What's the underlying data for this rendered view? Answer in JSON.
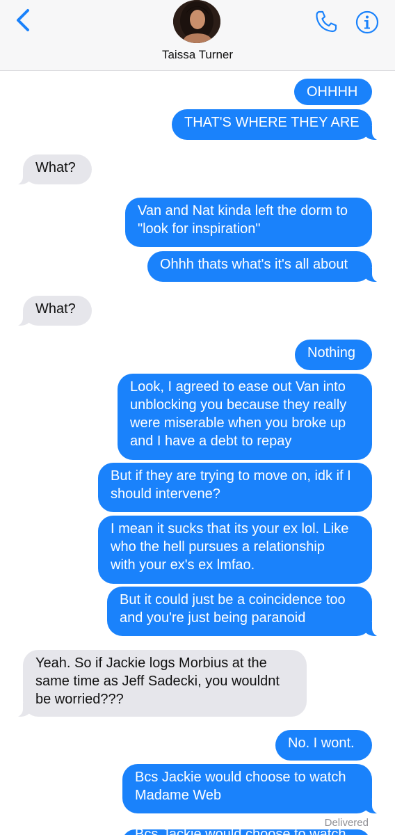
{
  "header": {
    "contact_name": "Taissa Turner",
    "accent_color": "#1a82fb",
    "icons": [
      "back-chevron-icon",
      "phone-icon",
      "info-icon"
    ]
  },
  "messages": [
    {
      "from": "me",
      "text": "OHHHH"
    },
    {
      "from": "me",
      "text": "THAT'S WHERE THEY ARE"
    },
    {
      "from": "them",
      "text": "What?"
    },
    {
      "from": "me",
      "text": "Van and Nat kinda left the dorm to\n\"look for inspiration\""
    },
    {
      "from": "me",
      "text": "Ohhh thats what's it's all about"
    },
    {
      "from": "them",
      "text": "What?"
    },
    {
      "from": "me",
      "text": "Nothing"
    },
    {
      "from": "me",
      "text": "Look, I agreed to ease out Van into\nunblocking you because they really\nwere miserable when you broke up\nand I have a debt to repay"
    },
    {
      "from": "me",
      "text": "But if they are trying to move on, idk if I\nshould intervene?"
    },
    {
      "from": "me",
      "text": "I mean it sucks that its your ex lol. Like\nwho the hell  pursues a relationship\nwith your ex's ex lmfao."
    },
    {
      "from": "me",
      "text": "But it could just be a coincidence too\nand you're just being paranoid"
    },
    {
      "from": "them",
      "text": "Yeah. So if Jackie logs Morbius at the\nsame time as Jeff Sadecki, you wouldnt\nbe worried???"
    },
    {
      "from": "me",
      "text": "No. I wont."
    },
    {
      "from": "me",
      "text": "Bcs Jackie would choose to watch\nMadame Web"
    }
  ],
  "status": {
    "delivered": "Delivered"
  },
  "partial_message": {
    "text": "Bcs Jackie would choose to watch"
  }
}
